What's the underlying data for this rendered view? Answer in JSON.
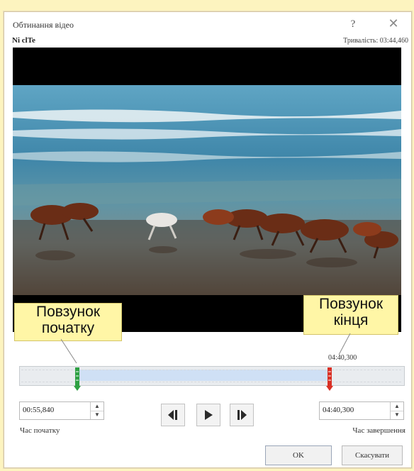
{
  "dialog": {
    "title": "Обтинання відео",
    "help": "?",
    "close": "✕"
  },
  "media": {
    "file_name": "Ni clTe",
    "duration": "Тривалість: 03:44,460"
  },
  "callouts": {
    "start_slider": "Повзунок початку",
    "end_slider": "Повзунок кінця"
  },
  "timeline": {
    "end_marker_time": "04:40,300",
    "start_color": "#2ea043",
    "end_color": "#d93025"
  },
  "controls": {
    "start_time_value": "00:55,840",
    "start_time_label": "Час початку",
    "end_time_value": "04:40,300",
    "end_time_label": "Час завершення",
    "prev_frame_icon": "previous-frame-icon",
    "play_icon": "play-icon",
    "next_frame_icon": "next-frame-icon"
  },
  "buttons": {
    "ok": "OK",
    "cancel": "Скасувати"
  }
}
